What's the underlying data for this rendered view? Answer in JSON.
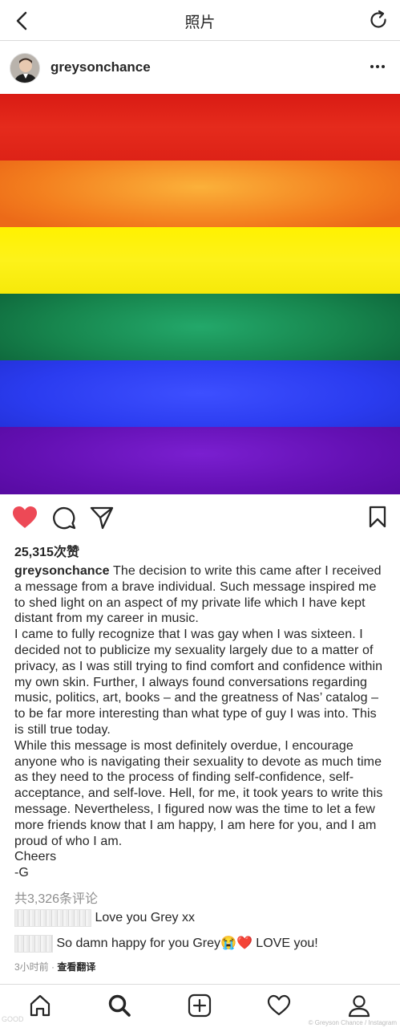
{
  "header": {
    "title": "照片",
    "back_icon": "chevron-left-icon",
    "refresh_icon": "refresh-icon"
  },
  "post": {
    "username": "greysonchance",
    "likes": "25,315次赞",
    "caption": {
      "username": "greysonchance",
      "p1": " The decision to write this came after I received a message from a brave individual. Such message inspired me to shed light on an aspect of my private life which I have kept distant from my career in music.",
      "p2": "I came to fully recognize that I was gay when I was sixteen. I decided not to publicize my sexuality largely due to a matter of privacy, as I was still trying to find comfort and confidence within my own skin. Further, I always found conversations regarding music, politics, art, books – and the greatness of Nas’ catalog – to be far more interesting than what type of guy I was into. This is still true today.",
      "p3": "While this message is most definitely overdue, I encourage anyone who is navigating their sexuality to devote as much time as they need to the process of finding self-confidence, self-acceptance, and self-love. Hell, for me, it took years to write this message. Nevertheless, I figured now was the time to let a few more friends know that I am happy, I am here for you, and I am proud of who I am.",
      "p4": "Cheers",
      "p5": "-G"
    },
    "comments_count": "共3,326条评论",
    "comments": [
      {
        "text": "Love you Grey xx"
      },
      {
        "text_before": "So damn happy for you Grey",
        "emoji": "😭❤️",
        "text_after": " LOVE you!"
      }
    ],
    "time": "3小时前",
    "separator": " · ",
    "translate": "查看翻译",
    "colors": {
      "like": "#ed4956",
      "stripes": [
        "#e2231a",
        "#f6851f",
        "#fff200",
        "#1d9c5b",
        "#2a3df5",
        "#6a12b8"
      ]
    }
  },
  "credit": "© Greyson Chance / Instagram",
  "watermark": "GOOD"
}
